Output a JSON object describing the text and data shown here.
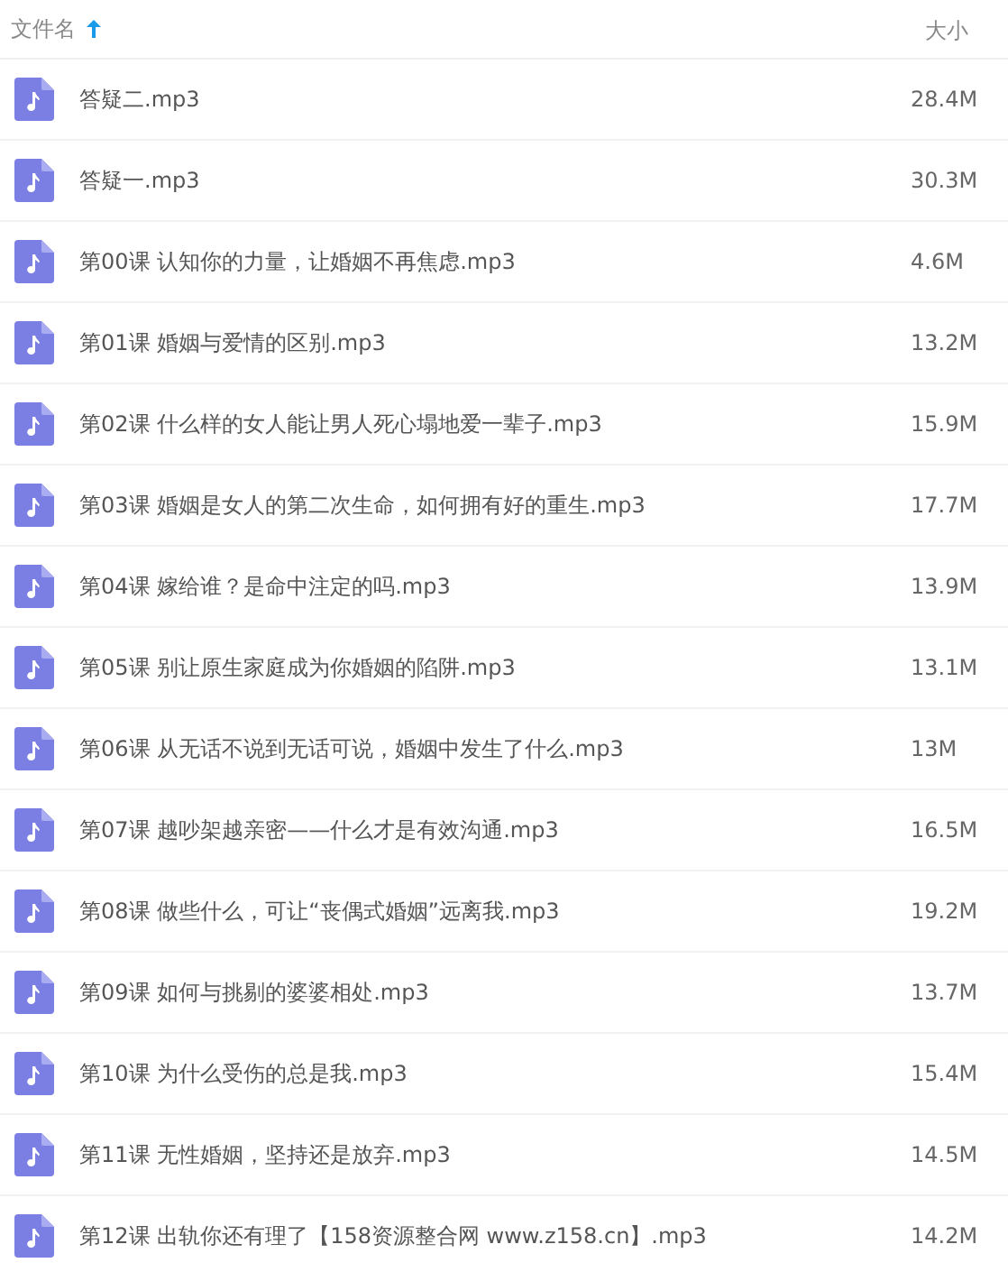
{
  "table": {
    "columns": [
      {
        "label": "文件名",
        "sorted": true
      },
      {
        "label": "大小",
        "sorted": false
      }
    ],
    "rows": [
      {
        "name": "答疑二.mp3",
        "size": "28.4M"
      },
      {
        "name": "答疑一.mp3",
        "size": "30.3M"
      },
      {
        "name": "第00课 认知你的力量，让婚姻不再焦虑.mp3",
        "size": "4.6M"
      },
      {
        "name": "第01课 婚姻与爱情的区别.mp3",
        "size": "13.2M"
      },
      {
        "name": "第02课 什么样的女人能让男人死心塌地爱一辈子.mp3",
        "size": "15.9M"
      },
      {
        "name": "第03课 婚姻是女人的第二次生命，如何拥有好的重生.mp3",
        "size": "17.7M"
      },
      {
        "name": "第04课 嫁给谁？是命中注定的吗.mp3",
        "size": "13.9M"
      },
      {
        "name": "第05课 别让原生家庭成为你婚姻的陷阱.mp3",
        "size": "13.1M"
      },
      {
        "name": "第06课 从无话不说到无话可说，婚姻中发生了什么.mp3",
        "size": "13M"
      },
      {
        "name": "第07课 越吵架越亲密——什么才是有效沟通.mp3",
        "size": "16.5M"
      },
      {
        "name": "第08课 做些什么，可让“丧偶式婚姻”远离我.mp3",
        "size": "19.2M"
      },
      {
        "name": "第09课 如何与挑剔的婆婆相处.mp3",
        "size": "13.7M"
      },
      {
        "name": "第10课 为什么受伤的总是我.mp3",
        "size": "15.4M"
      },
      {
        "name": "第11课 无性婚姻，坚持还是放弃.mp3",
        "size": "14.5M"
      },
      {
        "name": "第12课 出轨你还有理了【158资源整合网 www.z158.cn】.mp3",
        "size": "14.2M"
      }
    ]
  }
}
